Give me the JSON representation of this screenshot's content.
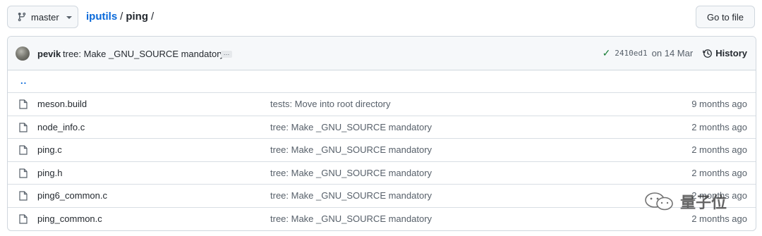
{
  "branch": {
    "name": "master",
    "icon": "git-branch-icon"
  },
  "breadcrumb": {
    "repo": "iputils",
    "sep1": "/",
    "dir": "ping",
    "sep2": "/"
  },
  "goto_file": {
    "label": "Go to file"
  },
  "commit": {
    "author": "pevik",
    "message": "tree: Make _GNU_SOURCE mandatory",
    "ellipsis": "…",
    "check_icon": "✓",
    "sha": "2410ed1",
    "date": "on 14 Mar",
    "history_label": "History"
  },
  "parent_dir": {
    "label": ".."
  },
  "files": [
    {
      "name": "meson.build",
      "message": "tests: Move into root directory",
      "age": "9 months ago"
    },
    {
      "name": "node_info.c",
      "message": "tree: Make _GNU_SOURCE mandatory",
      "age": "2 months ago"
    },
    {
      "name": "ping.c",
      "message": "tree: Make _GNU_SOURCE mandatory",
      "age": "2 months ago"
    },
    {
      "name": "ping.h",
      "message": "tree: Make _GNU_SOURCE mandatory",
      "age": "2 months ago"
    },
    {
      "name": "ping6_common.c",
      "message": "tree: Make _GNU_SOURCE mandatory",
      "age": "2 months ago"
    },
    {
      "name": "ping_common.c",
      "message": "tree: Make _GNU_SOURCE mandatory",
      "age": "2 months ago"
    }
  ],
  "watermark": {
    "text": "量子位"
  },
  "colors": {
    "link": "#0969da",
    "check": "#1a7f37",
    "border": "#d0d7de"
  }
}
